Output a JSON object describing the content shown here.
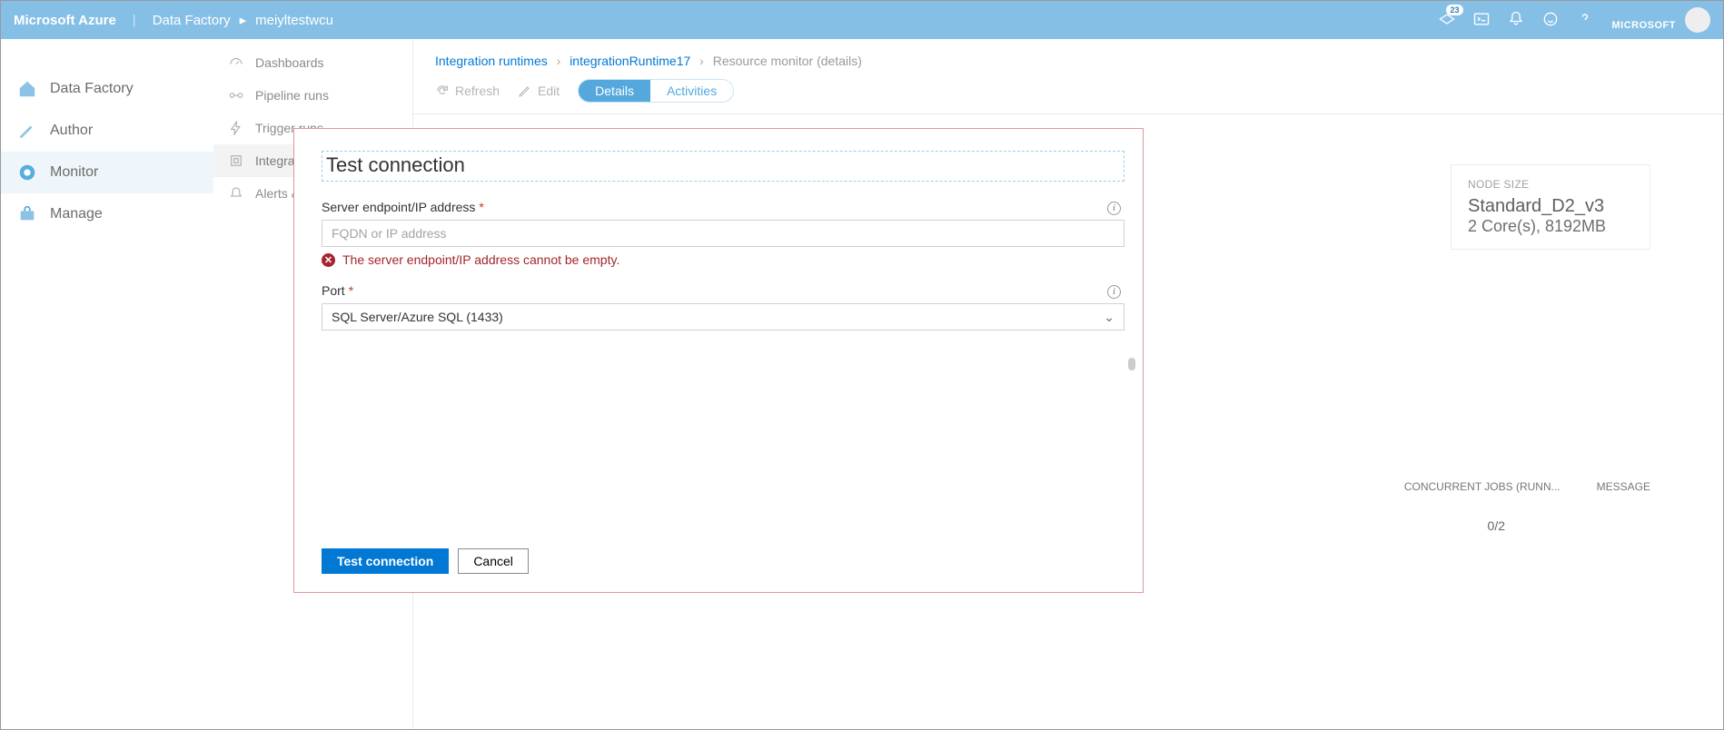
{
  "topbar": {
    "product": "Microsoft Azure",
    "service": "Data Factory",
    "instance": "meiyltestwcu",
    "tenant": "MICROSOFT",
    "notification_count": "23"
  },
  "leftnav": {
    "items": [
      {
        "label": "Data Factory"
      },
      {
        "label": "Author"
      },
      {
        "label": "Monitor"
      },
      {
        "label": "Manage"
      }
    ]
  },
  "subnav": {
    "items": [
      {
        "label": "Dashboards"
      },
      {
        "label": "Pipeline runs"
      },
      {
        "label": "Trigger runs"
      },
      {
        "label": "Integrati..."
      },
      {
        "label": "Alerts &..."
      }
    ]
  },
  "crumbs": {
    "a": "Integration runtimes",
    "b": "integrationRuntime17",
    "c": "Resource monitor (details)"
  },
  "toolbar": {
    "refresh": "Refresh",
    "edit": "Edit",
    "pill_details": "Details",
    "pill_activities": "Activities"
  },
  "info_card": {
    "label": "NODE SIZE",
    "line1": "Standard_D2_v3",
    "line2": "2 Core(s), 8192MB"
  },
  "grid": {
    "h1": "CONCURRENT JOBS (RUNN...",
    "h2": "MESSAGE",
    "val": "0/2"
  },
  "dialog": {
    "title": "Test connection",
    "field1_label": "Server endpoint/IP address",
    "field1_placeholder": "FQDN or IP address",
    "field1_error": "The server endpoint/IP address cannot be empty.",
    "field2_label": "Port",
    "field2_value": "SQL Server/Azure SQL (1433)",
    "btn_primary": "Test connection",
    "btn_cancel": "Cancel"
  }
}
